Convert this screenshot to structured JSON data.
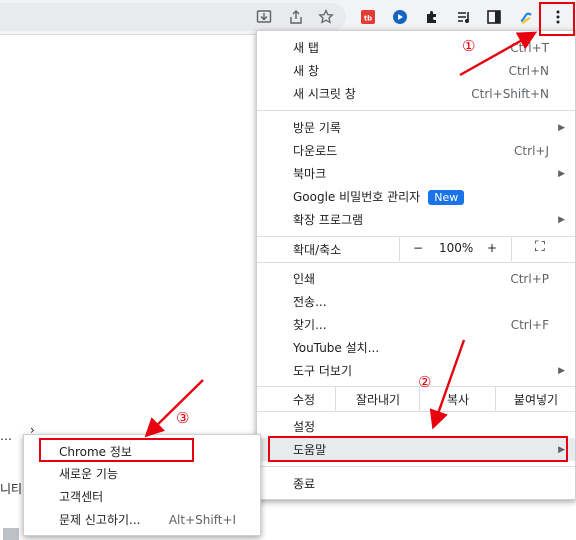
{
  "menu": {
    "items": [
      {
        "label": "새 탭",
        "shortcut": "Ctrl+T"
      },
      {
        "label": "새 창",
        "shortcut": "Ctrl+N"
      },
      {
        "label": "새 시크릿 창",
        "shortcut": "Ctrl+Shift+N"
      },
      {
        "label": "방문 기록"
      },
      {
        "label": "다운로드",
        "shortcut": "Ctrl+J"
      },
      {
        "label": "북마크"
      },
      {
        "label": "Google 비밀번호 관리자",
        "badge": "New"
      },
      {
        "label": "확장 프로그램"
      },
      {
        "label": "인쇄",
        "shortcut": "Ctrl+P"
      },
      {
        "label": "전송..."
      },
      {
        "label": "찾기...",
        "shortcut": "Ctrl+F"
      },
      {
        "label": "YouTube 설치..."
      },
      {
        "label": "도구 더보기"
      },
      {
        "label": "설정"
      },
      {
        "label": "도움말"
      },
      {
        "label": "종료"
      }
    ],
    "zoom": {
      "label": "확대/축소",
      "minus": "−",
      "value": "100%",
      "plus": "+",
      "fullscreen": "⛶"
    },
    "edit": {
      "label": "수정",
      "cut": "잘라내기",
      "copy": "복사",
      "paste": "붙여넣기"
    }
  },
  "submenu": {
    "items": [
      {
        "label": "Chrome 정보"
      },
      {
        "label": "새로운 기능"
      },
      {
        "label": "고객센터"
      },
      {
        "label": "문제 신고하기...",
        "shortcut": "Alt+Shift+I"
      }
    ]
  },
  "annotations": {
    "step1": "①",
    "step2": "②",
    "step3": "③"
  },
  "background": {
    "frag1": "…",
    "frag2": "니티",
    "chevron": "›"
  },
  "colors": {
    "annotation": "#e8000f",
    "accent": "#1a73e8"
  }
}
